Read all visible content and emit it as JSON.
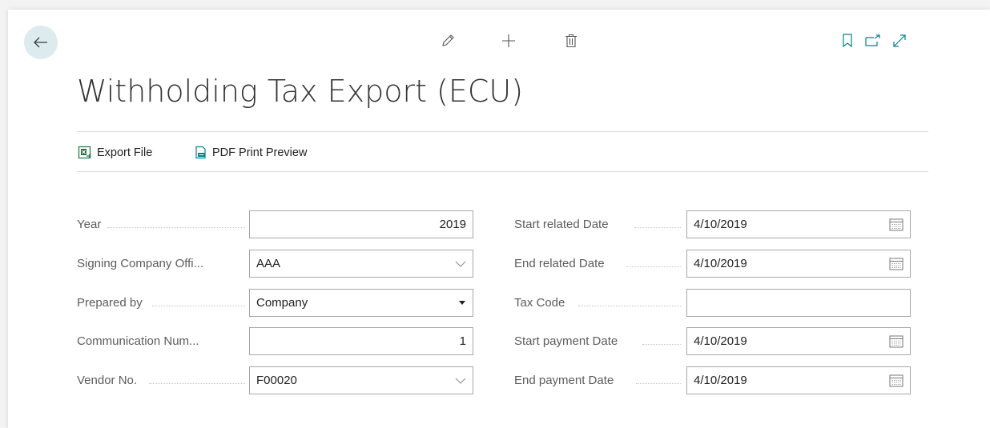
{
  "page": {
    "title": "Withholding Tax Export (ECU)"
  },
  "toolbar": {
    "icons": [
      "back-arrow-icon",
      "edit-pencil-icon",
      "plus-icon",
      "trash-icon",
      "bookmark-icon",
      "open-new-window-icon",
      "expand-icon"
    ]
  },
  "actions": {
    "export_file": "Export File",
    "pdf_print_preview": "PDF Print Preview"
  },
  "form": {
    "left": [
      {
        "label": "Year",
        "value": "2019",
        "kind": "number"
      },
      {
        "label": "Signing Company Offi...",
        "value": "AAA",
        "kind": "lookup"
      },
      {
        "label": "Prepared by",
        "value": "Company",
        "kind": "select"
      },
      {
        "label": "Communication Num...",
        "value": "1",
        "kind": "number"
      },
      {
        "label": "Vendor No.",
        "value": "F00020",
        "kind": "lookup"
      }
    ],
    "right": [
      {
        "label": "Start related Date",
        "value": "4/10/2019",
        "kind": "date"
      },
      {
        "label": "End related Date",
        "value": "4/10/2019",
        "kind": "date"
      },
      {
        "label": "Tax Code",
        "value": "",
        "kind": "text"
      },
      {
        "label": "Start payment Date",
        "value": "4/10/2019",
        "kind": "date"
      },
      {
        "label": "End payment Date",
        "value": "4/10/2019",
        "kind": "date"
      }
    ]
  },
  "colors": {
    "accent": "#00838f",
    "back_button_bg": "#dcebed",
    "excel_green": "#217346"
  }
}
